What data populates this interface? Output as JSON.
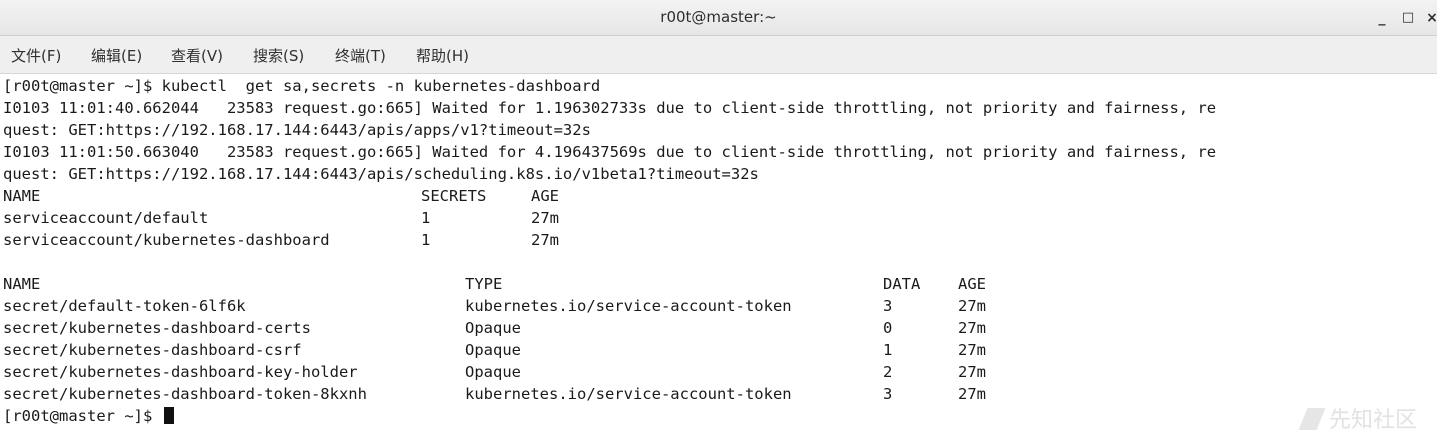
{
  "window": {
    "title": "r00t@master:~",
    "minimize_glyph": "_",
    "maximize_glyph": "□",
    "close_glyph": "×"
  },
  "menu": {
    "file": "文件(F)",
    "edit": "编辑(E)",
    "view": "查看(V)",
    "search": "搜索(S)",
    "terminal": "终端(T)",
    "help": "帮助(H)"
  },
  "terminal": {
    "lines": {
      "cmd": "[r00t@master ~]$ kubectl  get sa,secrets -n kubernetes-dashboard",
      "warn1a": "I0103 11:01:40.662044   23583 request.go:665] Waited for 1.196302733s due to client-side throttling, not priority and fairness, re",
      "warn1b": "quest: GET:https://192.168.17.144:6443/apis/apps/v1?timeout=32s",
      "warn2a": "I0103 11:01:50.663040   23583 request.go:665] Waited for 4.196437569s due to client-side throttling, not priority and fairness, re",
      "warn2b": "quest: GET:https://192.168.17.144:6443/apis/scheduling.k8s.io/v1beta1?timeout=32s",
      "prompt": "[r00t@master ~]$ "
    },
    "sa_table": {
      "headers": [
        "NAME",
        "SECRETS",
        "AGE"
      ],
      "rows": [
        [
          "serviceaccount/default",
          "1",
          "27m"
        ],
        [
          "serviceaccount/kubernetes-dashboard",
          "1",
          "27m"
        ]
      ]
    },
    "secret_table": {
      "headers": [
        "NAME",
        "TYPE",
        "DATA",
        "AGE"
      ],
      "rows": [
        [
          "secret/default-token-6lf6k",
          "kubernetes.io/service-account-token",
          "3",
          "27m"
        ],
        [
          "secret/kubernetes-dashboard-certs",
          "Opaque",
          "0",
          "27m"
        ],
        [
          "secret/kubernetes-dashboard-csrf",
          "Opaque",
          "1",
          "27m"
        ],
        [
          "secret/kubernetes-dashboard-key-holder",
          "Opaque",
          "2",
          "27m"
        ],
        [
          "secret/kubernetes-dashboard-token-8kxnh",
          "kubernetes.io/service-account-token",
          "3",
          "27m"
        ]
      ]
    }
  },
  "watermark": {
    "text": "先知社区"
  }
}
